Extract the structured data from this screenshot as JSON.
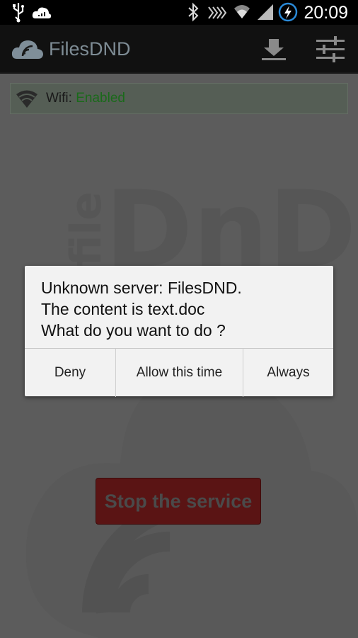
{
  "status_bar": {
    "time": "20:09",
    "icons": [
      "usb-icon",
      "cloud-icon",
      "bluetooth-icon",
      "nfc-icon",
      "wifi-icon",
      "signal-icon",
      "battery-charging-icon"
    ]
  },
  "app": {
    "title": "FilesDND",
    "actions": [
      "download-icon",
      "settings-sliders-icon"
    ]
  },
  "wifi": {
    "label": "Wifi: ",
    "status": "Enabled"
  },
  "service_button": {
    "label": "Stop the service"
  },
  "dialog": {
    "lines": [
      "Unknown server: FilesDND.",
      "The content is text.doc",
      "What do you want to do ?"
    ],
    "buttons": {
      "deny": "Deny",
      "allow_once": "Allow this time",
      "always": "Always"
    }
  },
  "colors": {
    "status_enabled": "#1a6a1a",
    "stop_button": "#5a1414",
    "dialog_bg": "#f2f2f2",
    "app_title": "#7e8c95"
  }
}
